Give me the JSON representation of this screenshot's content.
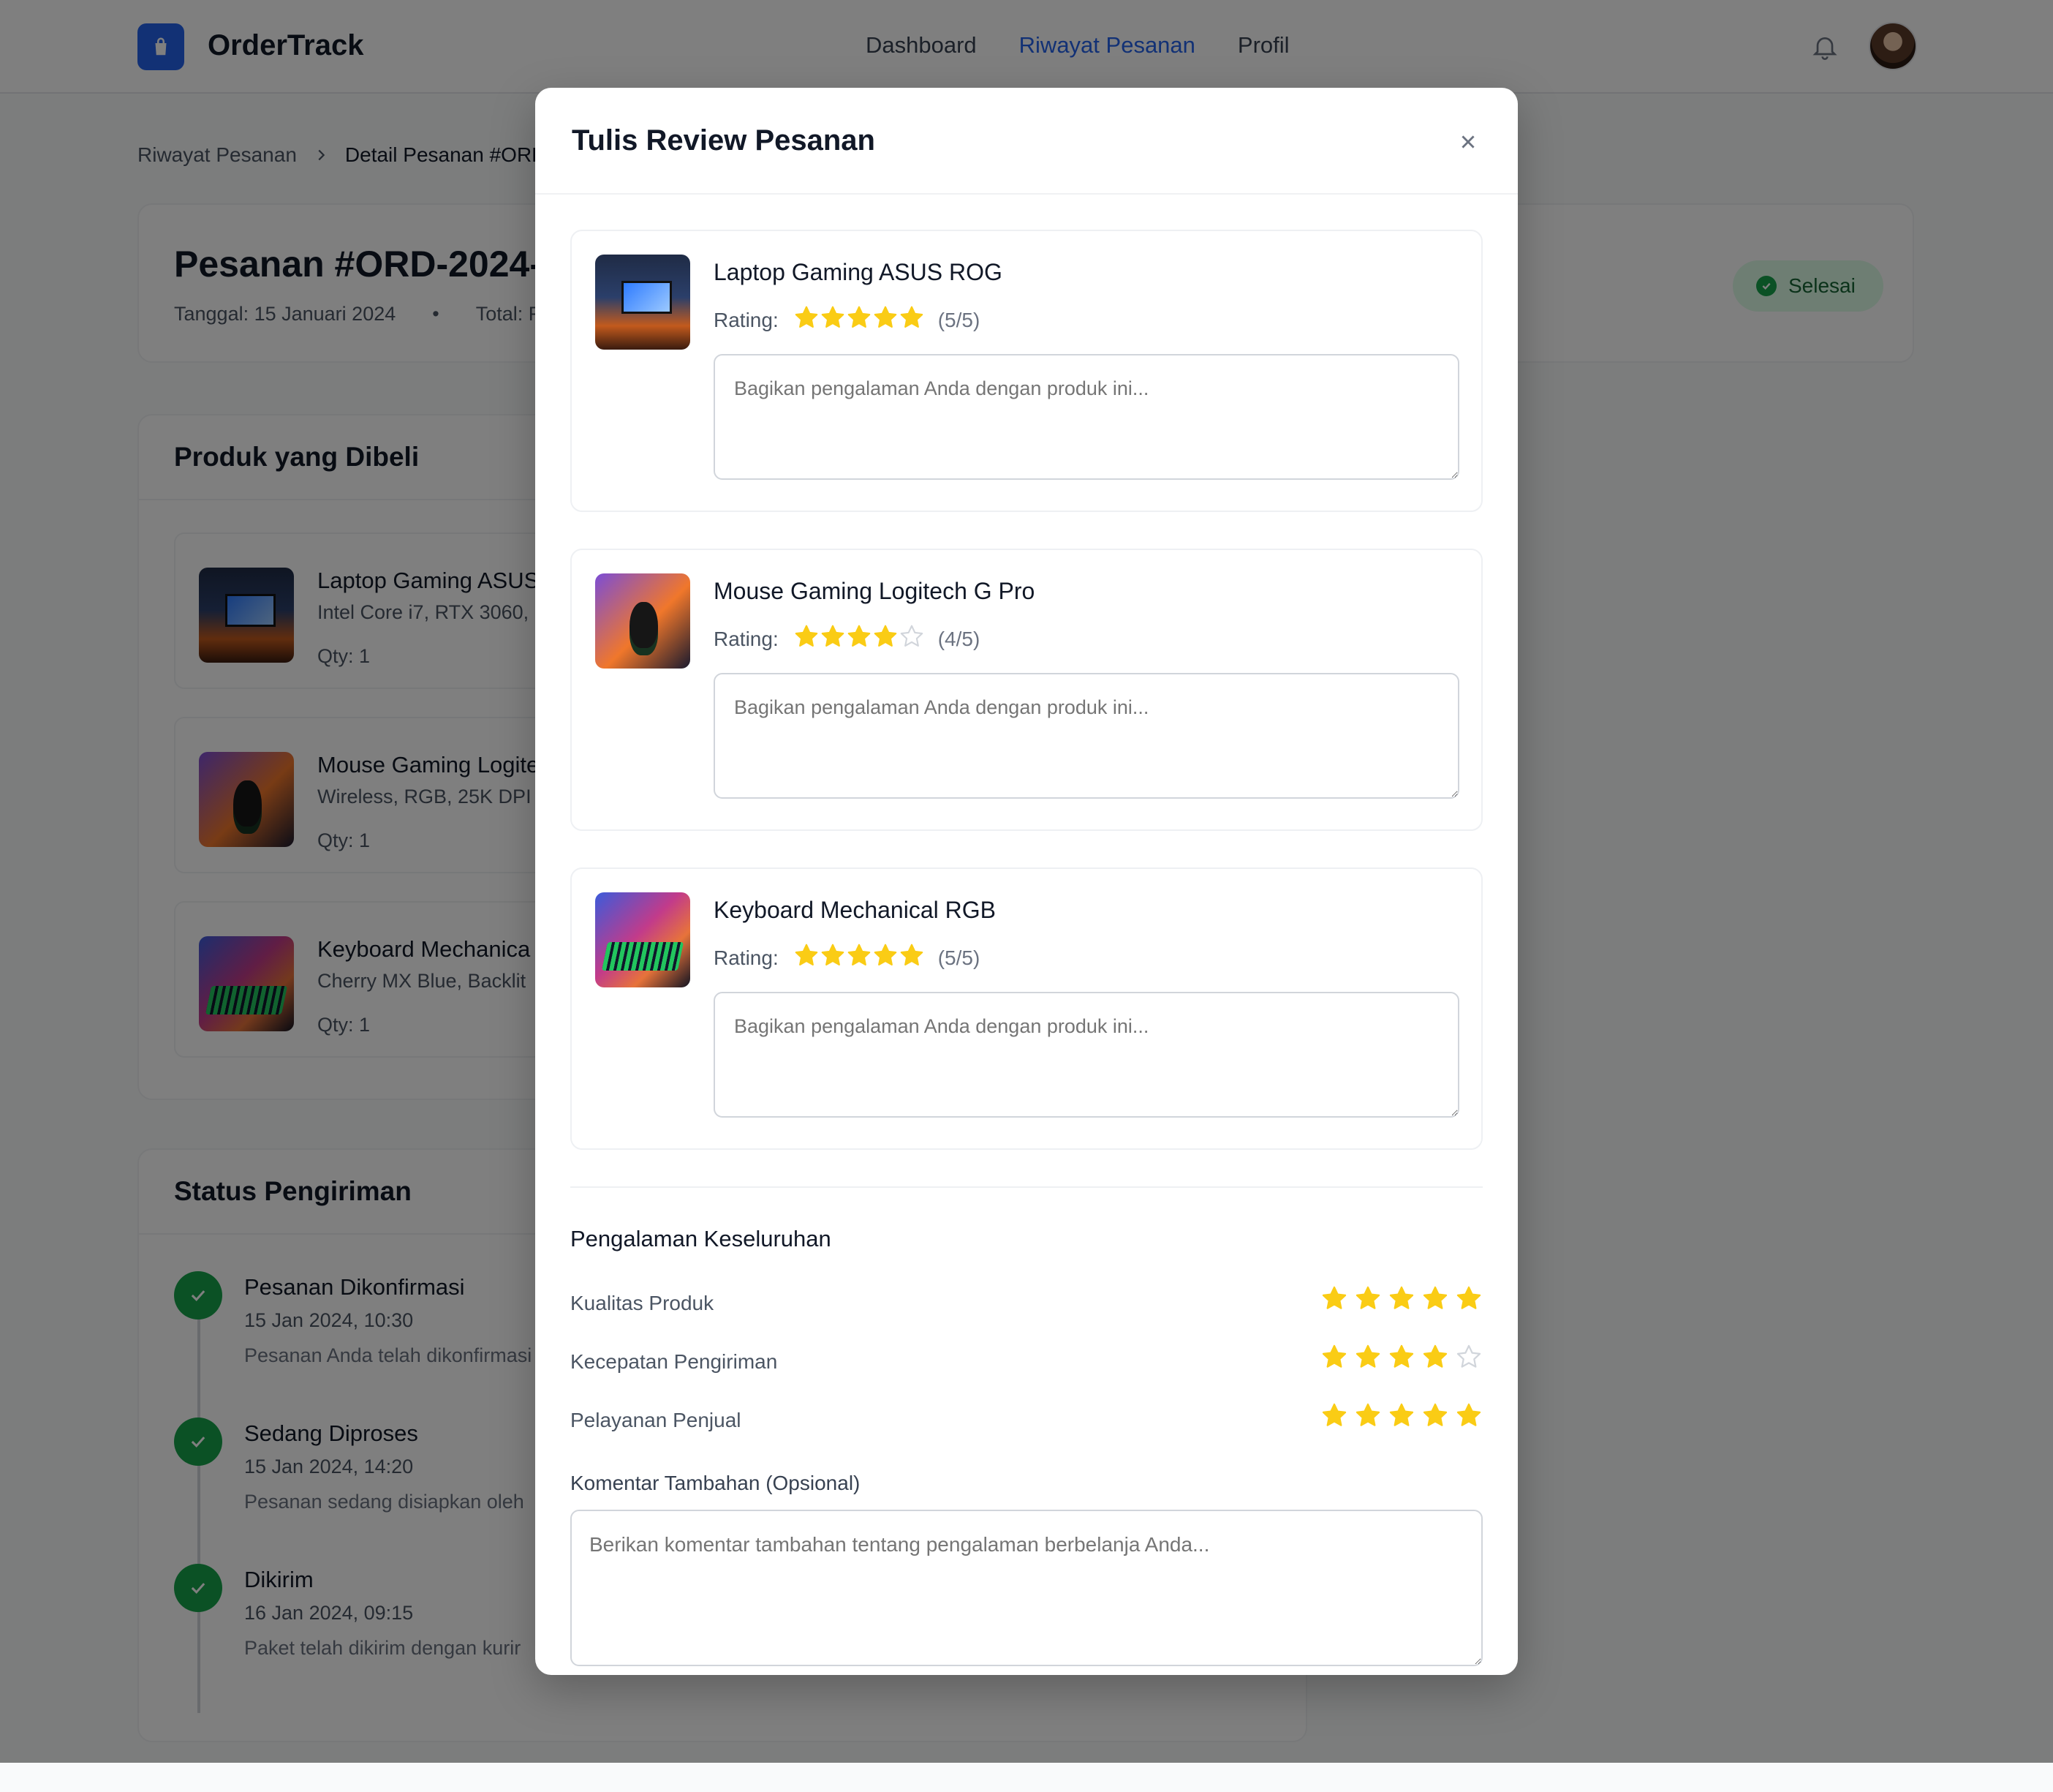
{
  "header": {
    "brand": "OrderTrack",
    "nav": [
      "Dashboard",
      "Riwayat Pesanan",
      "Profil"
    ],
    "active_nav": "Riwayat Pesanan"
  },
  "breadcrumb": {
    "parent": "Riwayat Pesanan",
    "current": "Detail Pesanan #ORD"
  },
  "order": {
    "title": "Pesanan #ORD-2024-0",
    "date": "Tanggal: 15 Januari 2024",
    "bullet": "•",
    "total": "Total: R",
    "status": "Selesai",
    "status_color": "#16a34a"
  },
  "products": {
    "title": "Produk yang Dibeli",
    "items": [
      {
        "name": "Laptop Gaming ASUS",
        "spec": "Intel Core i7, RTX 3060,",
        "qty": "Qty: 1"
      },
      {
        "name": "Mouse Gaming Logite",
        "spec": "Wireless, RGB, 25K DPI",
        "qty": "Qty: 1"
      },
      {
        "name": "Keyboard Mechanica",
        "spec": "Cherry MX Blue, Backlit",
        "qty": "Qty: 1"
      }
    ]
  },
  "shipping": {
    "title": "Status Pengiriman",
    "steps": [
      {
        "title": "Pesanan Dikonfirmasi",
        "time": "15 Jan 2024, 10:30",
        "desc": "Pesanan Anda telah dikonfirmasi"
      },
      {
        "title": "Sedang Diproses",
        "time": "15 Jan 2024, 14:20",
        "desc": "Pesanan sedang disiapkan oleh"
      },
      {
        "title": "Dikirim",
        "time": "16 Jan 2024, 09:15",
        "desc": "Paket telah dikirim dengan kurir"
      }
    ]
  },
  "modal": {
    "title": "Tulis Review Pesanan",
    "rating_label": "Rating:",
    "reviews": [
      {
        "name": "Laptop Gaming ASUS ROG",
        "rating": 5,
        "rating_text": "(5/5)",
        "placeholder": "Bagikan pengalaman Anda dengan produk ini..."
      },
      {
        "name": "Mouse Gaming Logitech G Pro",
        "rating": 4,
        "rating_text": "(4/5)",
        "placeholder": "Bagikan pengalaman Anda dengan produk ini..."
      },
      {
        "name": "Keyboard Mechanical RGB",
        "rating": 5,
        "rating_text": "(5/5)",
        "placeholder": "Bagikan pengalaman Anda dengan produk ini..."
      }
    ],
    "overall": {
      "title": "Pengalaman Keseluruhan",
      "rows": [
        {
          "label": "Kualitas Produk",
          "rating": 5
        },
        {
          "label": "Kecepatan Pengiriman",
          "rating": 4
        },
        {
          "label": "Pelayanan Penjual",
          "rating": 5
        }
      ]
    },
    "extra": {
      "label": "Komentar Tambahan (Opsional)",
      "placeholder": "Berikan komentar tambahan tentang pengalaman berbelanja Anda..."
    }
  },
  "colors": {
    "accent": "#2563eb",
    "star": "#facc15",
    "success": "#16a34a"
  }
}
